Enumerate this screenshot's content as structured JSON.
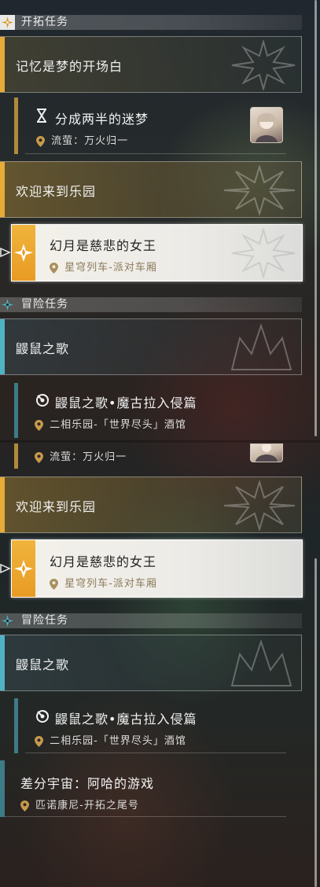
{
  "colors": {
    "gold": "#e7ab3a",
    "cyan": "#4fb3c4",
    "gold_dark": "#b08a3a",
    "teal_dark": "#3d7b86"
  },
  "top_panel": {
    "trailblaze_header": "开拓任务",
    "quest_memory": "记忆是梦的开场白",
    "sub_dream": {
      "title": "分成两半的迷梦",
      "location": "流萤：万火归一",
      "icon": "hourglass-icon"
    },
    "quest_paradise": "欢迎来到乐园",
    "sub_queen": {
      "title": "幻月是慈悲的女王",
      "location": "星穹列车-派对车厢"
    },
    "adventure_header": "冒险任务",
    "quest_song": "鼹鼠之歌",
    "sub_song": {
      "title": "鼹鼠之歌•魔古拉入侵篇",
      "location": "二相乐园-「世界尽头」酒馆"
    }
  },
  "bottom_panel": {
    "partial_location": "流萤：万火归一",
    "quest_paradise": "欢迎来到乐园",
    "sub_queen": {
      "title": "幻月是慈悲的女王",
      "location": "星穹列车-派对车厢"
    },
    "adventure_header": "冒险任务",
    "quest_song": "鼹鼠之歌",
    "sub_song": {
      "title": "鼹鼠之歌•魔古拉入侵篇",
      "location": "二相乐园-「世界尽头」酒馆"
    },
    "sub_universe": {
      "title": "差分宇宙：阿哈的游戏",
      "location": "匹诺康尼-开拓之尾号"
    }
  }
}
